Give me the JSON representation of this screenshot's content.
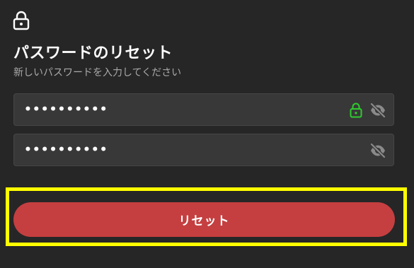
{
  "header": {
    "title": "パスワードのリセット",
    "subtitle": "新しいパスワードを入力してください",
    "icon": "lock-icon"
  },
  "form": {
    "new_password": {
      "value": "••••••••••",
      "strength_icon": "lock-icon",
      "strength_color": "#2ecc2e",
      "toggle_icon": "eye-slash-icon",
      "toggle_color": "#8a8a8a"
    },
    "confirm_password": {
      "value": "••••••••••",
      "toggle_icon": "eye-slash-icon",
      "toggle_color": "#8a8a8a"
    }
  },
  "actions": {
    "reset_label": "リセット",
    "reset_color": "#c53f40",
    "highlight_color": "#ffff00"
  }
}
